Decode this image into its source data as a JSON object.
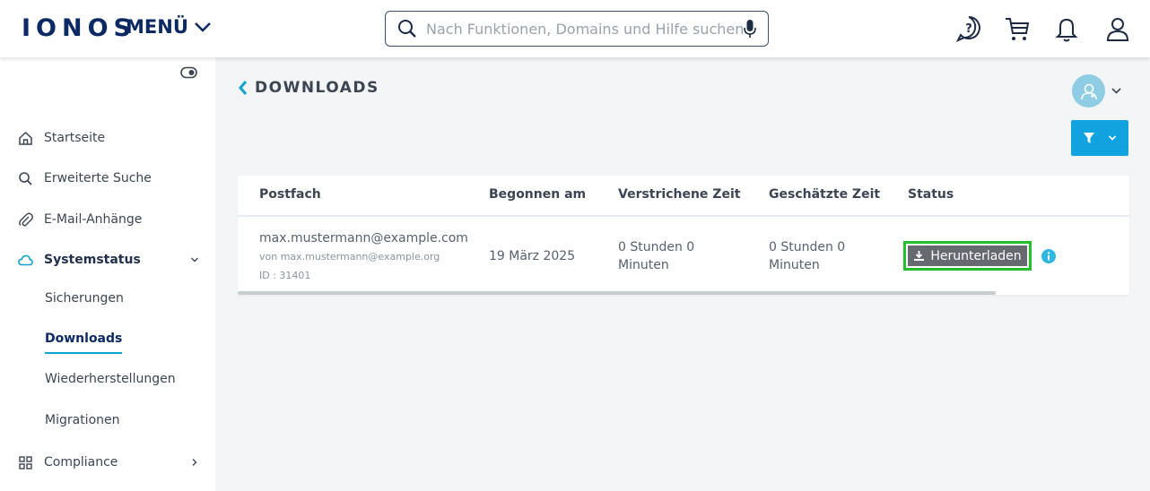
{
  "header": {
    "logo": "IONOS",
    "menu_label": "MENÜ",
    "search_placeholder": "Nach Funktionen, Domains und Hilfe suchen"
  },
  "sidebar": {
    "items": [
      {
        "label": "Startseite",
        "icon": "home-icon"
      },
      {
        "label": "Erweiterte Suche",
        "icon": "search-icon"
      },
      {
        "label": "E-Mail-Anhänge",
        "icon": "paperclip-icon"
      },
      {
        "label": "Systemstatus",
        "icon": "cloud-icon",
        "expanded": true
      },
      {
        "label": "Compliance",
        "icon": "grid-icon"
      }
    ],
    "subitems": [
      {
        "label": "Sicherungen"
      },
      {
        "label": "Downloads",
        "active": true
      },
      {
        "label": "Wiederherstellungen"
      },
      {
        "label": "Migrationen"
      }
    ]
  },
  "main": {
    "title": "DOWNLOADS",
    "table": {
      "columns": [
        "Postfach",
        "Begonnen am",
        "Verstrichene Zeit",
        "Geschätzte Zeit",
        "Status"
      ],
      "rows": [
        {
          "mailbox": "max.mustermann@example.com",
          "from": "von max.mustermann@example.org",
          "id": "ID : 31401",
          "started": "19 März 2025",
          "elapsed": "0 Stunden 0 Minuten",
          "estimated": "0 Stunden 0 Minuten",
          "status_button": "Herunterladen"
        }
      ]
    }
  },
  "colors": {
    "brand": "#0b2a63",
    "accent": "#11a3e0",
    "highlight": "#22c02a"
  }
}
